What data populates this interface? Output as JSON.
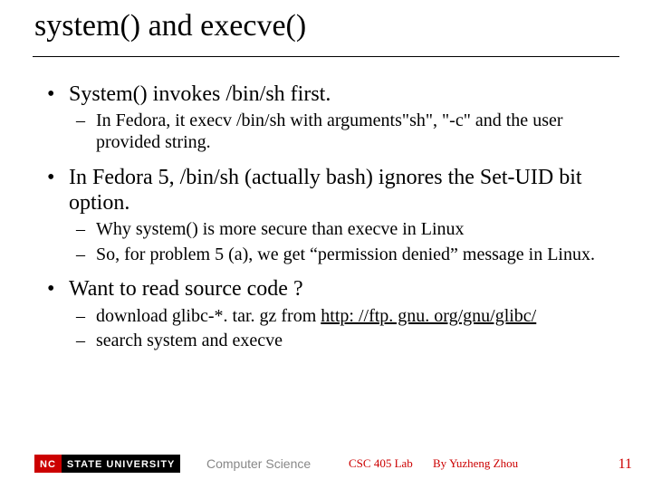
{
  "title": "system() and execve()",
  "bullets": [
    {
      "text": "System() invokes /bin/sh first.",
      "sub": [
        "In Fedora, it execv /bin/sh with arguments\"sh\", \"-c\" and the user provided string."
      ]
    },
    {
      "text": "In Fedora 5, /bin/sh (actually bash) ignores the Set-UID bit option.",
      "sub": [
        "Why system() is more secure than execve in Linux",
        "So, for problem 5 (a), we get “permission denied” message in Linux."
      ]
    },
    {
      "text": "Want to read source code ?",
      "sub": [
        {
          "prefix": "download glibc-*. tar. gz from ",
          "link": "http: //ftp. gnu. org/gnu/glibc/"
        },
        "search system and execve"
      ]
    }
  ],
  "footer": {
    "logo_left": "NC",
    "logo_right": "STATE UNIVERSITY",
    "cs": "Computer Science",
    "course": "CSC 405 Lab",
    "author": "By Yuzheng Zhou",
    "page": "11"
  }
}
